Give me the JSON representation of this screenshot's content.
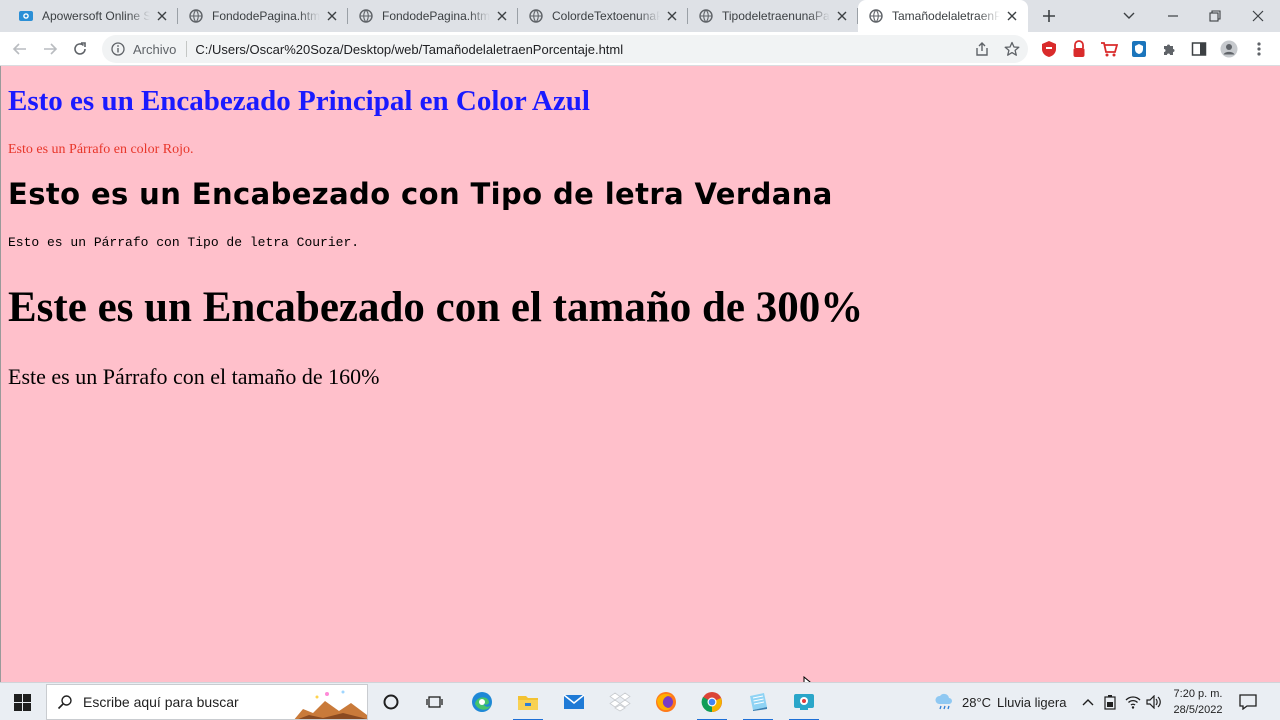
{
  "browser": {
    "tabs": [
      {
        "title": "Apowersoft Online Screen Recorder",
        "favicon": "apowersoft-icon"
      },
      {
        "title": "FondodePagina.html",
        "favicon": "globe-icon"
      },
      {
        "title": "FondodePagina.html",
        "favicon": "globe-icon"
      },
      {
        "title": "ColordeTextoenunaPagina.html",
        "favicon": "globe-icon"
      },
      {
        "title": "TipodeletraenunaPagina.html",
        "favicon": "globe-icon"
      },
      {
        "title": "TamañodelaletraenPorcentaje.html",
        "favicon": "globe-icon"
      }
    ],
    "active_tab": 5,
    "address": {
      "scheme_label": "Archivo",
      "url": "C:/Users/Oscar%20Soza/Desktop/web/TamañodelaletraenPorcentaje.html"
    }
  },
  "page": {
    "background": "#ffc0cb",
    "heading_main": "Esto es un Encabezado Principal en Color Azul",
    "paragraph_red": "Esto es un Párrafo en color Rojo.",
    "heading_verdana": "Esto es un Encabezado con Tipo de letra Verdana",
    "paragraph_courier": "Esto es un Párrafo con Tipo de letra Courier.",
    "heading_300": "Este es un Encabezado con el tamaño de 300%",
    "paragraph_160": "Este es un Párrafo con el tamaño de 160%",
    "colors": {
      "heading_blue": "#1a1aff",
      "paragraph_red": "#e8362a"
    }
  },
  "taskbar": {
    "search_placeholder": "Escribe aquí para buscar",
    "apps": [
      "cortana-icon",
      "task-view-icon",
      "edge-icon",
      "file-explorer-icon",
      "mail-icon",
      "dropbox-icon",
      "firefox-icon",
      "chrome-icon",
      "notepad-icon",
      "screen-recorder-icon"
    ],
    "weather": {
      "temperature": "28°C",
      "condition": "Lluvia ligera"
    },
    "clock": {
      "time": "7:20 p. m.",
      "date": "28/5/2022"
    }
  }
}
